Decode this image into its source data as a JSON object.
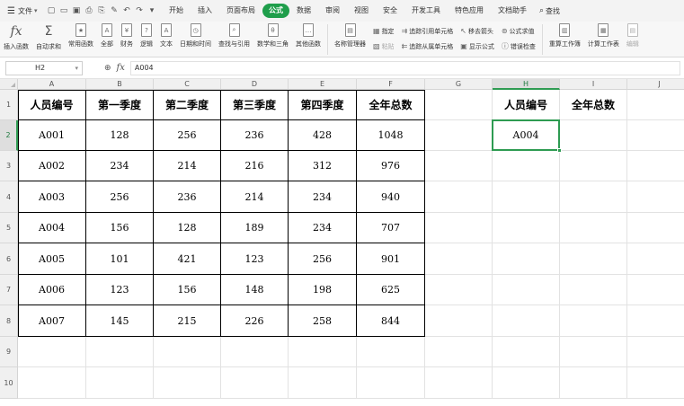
{
  "menubar": {
    "file_label": "文件",
    "tabs": [
      {
        "label": "开始",
        "active": false
      },
      {
        "label": "插入",
        "active": false
      },
      {
        "label": "页面布局",
        "active": false
      },
      {
        "label": "公式",
        "active": true
      },
      {
        "label": "数据",
        "active": false
      },
      {
        "label": "审阅",
        "active": false
      },
      {
        "label": "视图",
        "active": false
      },
      {
        "label": "安全",
        "active": false
      },
      {
        "label": "开发工具",
        "active": false
      },
      {
        "label": "特色应用",
        "active": false
      },
      {
        "label": "文档助手",
        "active": false
      }
    ],
    "search_label": "查找",
    "accent": "#1f9e4b"
  },
  "ribbon": {
    "insert_function": "插入函数",
    "autosum": "自动求和",
    "common_functions": "常用函数",
    "all": "全部",
    "finance": "财务",
    "logic": "逻辑",
    "text": "文本",
    "datetime": "日期和时间",
    "lookup": "查找与引用",
    "math": "数学和三角",
    "other": "其他函数",
    "name_manager": "名称管理器",
    "define": "指定",
    "paste": "粘贴",
    "trace_precedents": "追踪引用单元格",
    "trace_dependents": "追踪从属单元格",
    "remove_arrows": "移去箭头",
    "show_formulas": "显示公式",
    "evaluate": "公式求值",
    "error_check": "错误检查",
    "recalc_workbook": "重算工作簿",
    "calc_sheet": "计算工作表",
    "extra": "编辑"
  },
  "formula_bar": {
    "name_box": "H2",
    "fx_label": "fx",
    "value": "A004"
  },
  "columns": [
    "A",
    "B",
    "C",
    "D",
    "E",
    "F",
    "G",
    "H",
    "I",
    "J"
  ],
  "rows": [
    "1",
    "2",
    "3",
    "4",
    "5",
    "6",
    "7",
    "8",
    "9",
    "10"
  ],
  "table": {
    "headers": [
      "人员编号",
      "第一季度",
      "第二季度",
      "第三季度",
      "第四季度",
      "全年总数"
    ],
    "rows": [
      [
        "A001",
        "128",
        "256",
        "236",
        "428",
        "1048"
      ],
      [
        "A002",
        "234",
        "214",
        "216",
        "312",
        "976"
      ],
      [
        "A003",
        "256",
        "236",
        "214",
        "234",
        "940"
      ],
      [
        "A004",
        "156",
        "128",
        "189",
        "234",
        "707"
      ],
      [
        "A005",
        "101",
        "421",
        "123",
        "256",
        "901"
      ],
      [
        "A006",
        "123",
        "156",
        "148",
        "198",
        "625"
      ],
      [
        "A007",
        "145",
        "215",
        "226",
        "258",
        "844"
      ]
    ]
  },
  "lookup": {
    "header_h": "人员编号",
    "header_i": "全年总数",
    "value_h2": "A004",
    "value_i2": ""
  },
  "selection": {
    "cell": "H2",
    "color": "#2e9b52"
  }
}
